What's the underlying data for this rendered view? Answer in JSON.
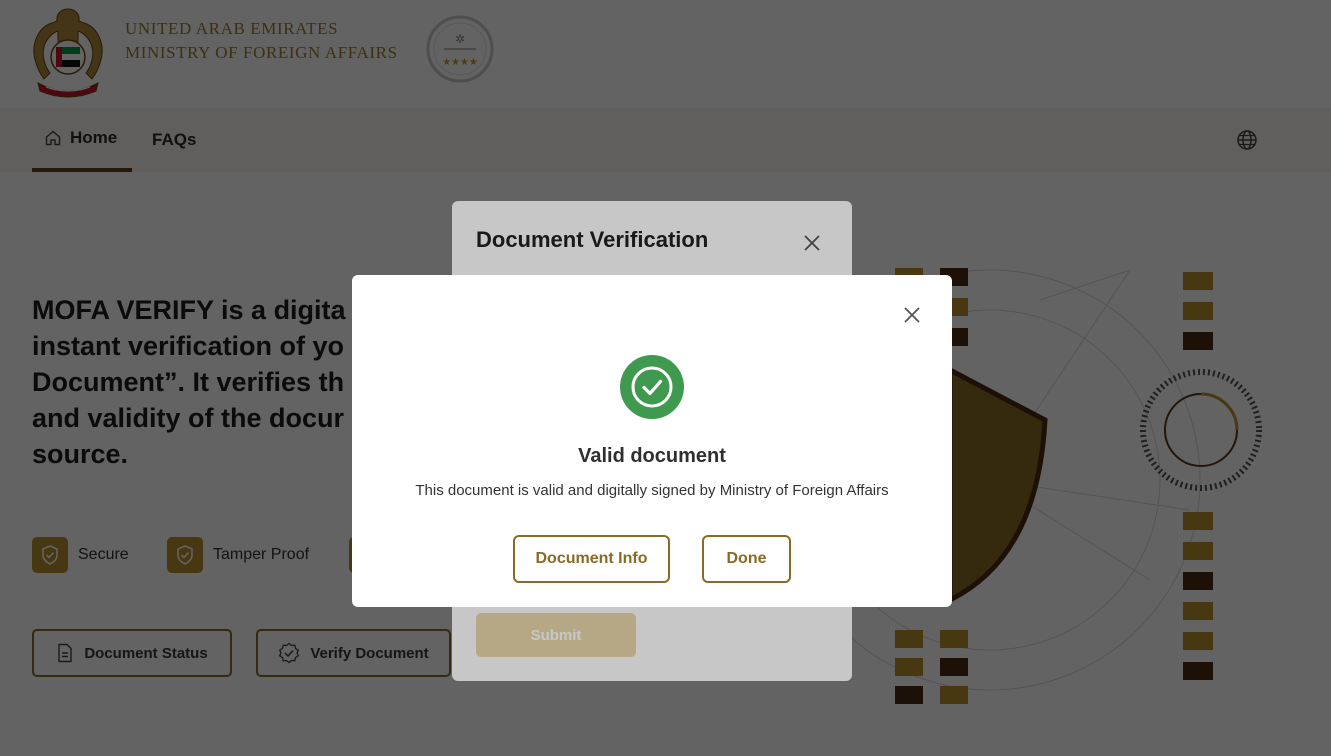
{
  "header": {
    "ministry_line1": "UNITED ARAB EMIRATES",
    "ministry_line2": "MINISTRY OF FOREIGN AFFAIRS",
    "emblem_icon": "uae-falcon-emblem-icon",
    "seal_icon": "government-star-rating-seal-icon"
  },
  "nav": {
    "items": [
      {
        "label": "Home",
        "icon": "home-icon",
        "active": true
      },
      {
        "label": "FAQs"
      }
    ],
    "language_icon": "globe-icon"
  },
  "hero": {
    "text": "MOFA VERIFY is a digita\ninstant verification of yo\nDocument”. It verifies th\nand validity of the docur\nsource."
  },
  "features": [
    {
      "label": "Secure",
      "icon": "shield-check-icon"
    },
    {
      "label": "Tamper Proof",
      "icon": "shield-check-icon"
    },
    {
      "label": "",
      "icon": "shield-check-icon"
    }
  ],
  "actions": {
    "document_status": "Document Status",
    "verify_document": "Verify Document"
  },
  "verification_dialog": {
    "title": "Document Verification",
    "submit": "Submit"
  },
  "result_dialog": {
    "title": "Valid document",
    "message": "This document is valid and digitally signed by Ministry of Foreign Affairs",
    "document_info": "Document Info",
    "done": "Done",
    "status_icon": "check-circle-icon"
  },
  "colors": {
    "brand_gold": "#a07a2c",
    "brand_brown": "#6b3d1c",
    "success_green": "#3f9a4f",
    "submit_disabled": "#e9d8a9"
  }
}
